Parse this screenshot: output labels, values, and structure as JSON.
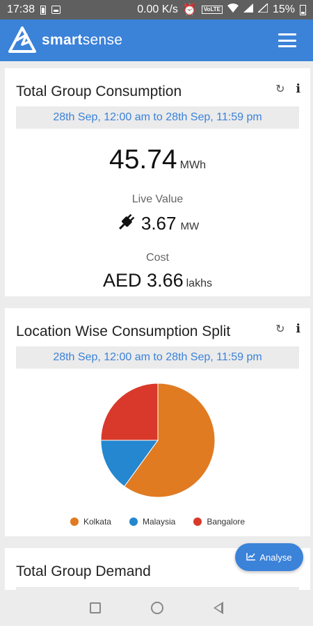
{
  "status_bar": {
    "time": "17:38",
    "network_speed": "0.00 K/s",
    "volte": "VoLTE",
    "battery": "15%"
  },
  "app_bar": {
    "brand_bold": "smart",
    "brand_light": "sense",
    "menu_icon": "hamburger-icon"
  },
  "total_consumption": {
    "title": "Total Group Consumption",
    "date_range": "28th Sep, 12:00 am  to 28th Sep, 11:59 pm",
    "value": "45.74",
    "unit": "MWh",
    "live_label": "Live Value",
    "live_value": "3.67",
    "live_unit": "MW",
    "cost_label": "Cost",
    "cost_value": "AED 3.66",
    "cost_unit": "lakhs"
  },
  "location_split": {
    "title": "Location Wise Consumption Split",
    "date_range": "28th Sep, 12:00 am  to 28th Sep, 11:59 pm"
  },
  "chart_data": {
    "type": "pie",
    "categories": [
      "Kolkata",
      "Malaysia",
      "Bangalore"
    ],
    "values": [
      60,
      15,
      25
    ],
    "colors": [
      "#e07b22",
      "#2487cf",
      "#d9392a"
    ],
    "legend_position": "bottom"
  },
  "total_demand": {
    "title": "Total Group Demand"
  },
  "analyse_button": {
    "label": "Analyse"
  },
  "colors": {
    "primary": "#3b82d9",
    "kolkata": "#e07b22",
    "malaysia": "#2487cf",
    "bangalore": "#d9392a"
  }
}
